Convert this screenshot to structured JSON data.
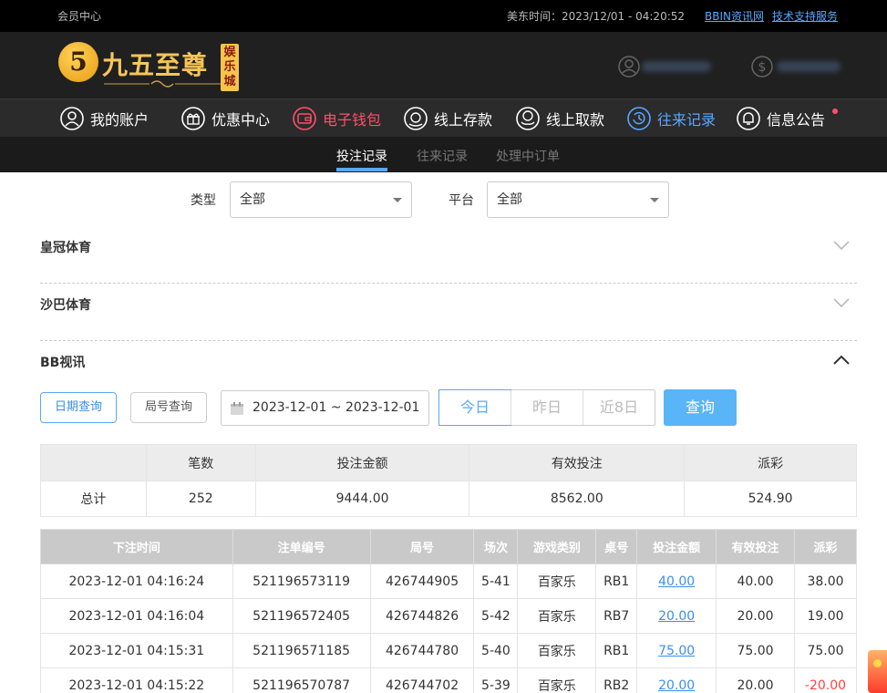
{
  "topbar": {
    "member_center": "会员中心",
    "time_label": "美东时间：2023/12/01 - 04:20:52",
    "links": [
      "BBIN资讯网",
      "技术支持服务"
    ]
  },
  "logo": {
    "numeral": "5",
    "name": "九五至尊",
    "tag": "娱乐城"
  },
  "nav": {
    "items": [
      {
        "label": "我的账户",
        "icon": "user-icon"
      },
      {
        "label": "优惠中心",
        "icon": "gift-icon"
      },
      {
        "label": "电子钱包",
        "icon": "wallet-icon"
      },
      {
        "label": "线上存款",
        "icon": "deposit-icon"
      },
      {
        "label": "线上取款",
        "icon": "withdraw-icon"
      },
      {
        "label": "往来记录",
        "icon": "records-icon"
      },
      {
        "label": "信息公告",
        "icon": "bell-icon"
      }
    ],
    "accent_red": "#ff4f6b",
    "accent_blue": "#5aa7ff"
  },
  "subtabs": [
    "投注记录",
    "往来记录",
    "处理中订单"
  ],
  "filters": {
    "type_label": "类型",
    "type_value": "全部",
    "platform_label": "平台",
    "platform_value": "全部"
  },
  "sections": [
    "皇冠体育",
    "沙巴体育",
    "BB视讯"
  ],
  "query": {
    "date_query": "日期查询",
    "round_query": "局号查询",
    "date_range": "2023-12-01 ~ 2023-12-01",
    "quick": [
      "今日",
      "昨日",
      "近8日"
    ],
    "submit": "查询"
  },
  "summary": {
    "headers": [
      "笔数",
      "投注金额",
      "有效投注",
      "派彩"
    ],
    "row_label": "总计",
    "values": [
      "252",
      "9444.00",
      "8562.00",
      "524.90"
    ]
  },
  "detail": {
    "headers": [
      "下注时间",
      "注单编号",
      "局号",
      "场次",
      "游戏类别",
      "桌号",
      "投注金额",
      "有效投注",
      "派彩"
    ],
    "rows": [
      [
        "2023-12-01 04:16:24",
        "521196573119",
        "426744905",
        "5-41",
        "百家乐",
        "RB1",
        "40.00",
        "40.00",
        "38.00"
      ],
      [
        "2023-12-01 04:16:04",
        "521196572405",
        "426744826",
        "5-42",
        "百家乐",
        "RB7",
        "20.00",
        "20.00",
        "19.00"
      ],
      [
        "2023-12-01 04:15:31",
        "521196571185",
        "426744780",
        "5-40",
        "百家乐",
        "RB1",
        "75.00",
        "75.00",
        "75.00"
      ],
      [
        "2023-12-01 04:15:22",
        "521196570787",
        "426744702",
        "5-39",
        "百家乐",
        "RB2",
        "20.00",
        "20.00",
        "-20.00"
      ]
    ]
  }
}
